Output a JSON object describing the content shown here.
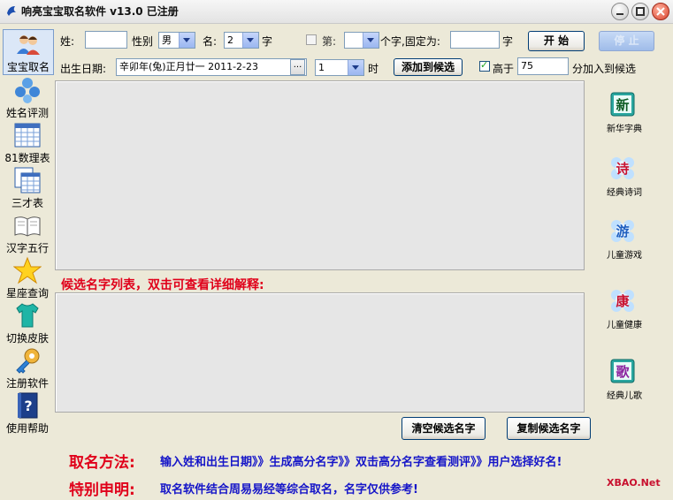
{
  "window": {
    "title": "响亮宝宝取名软件 v13.0  已注册"
  },
  "sidebar": {
    "items": [
      {
        "label": "宝宝取名",
        "icon": "people-icon"
      },
      {
        "label": "姓名评测",
        "icon": "dots-icon"
      },
      {
        "label": "81数理表",
        "icon": "table-icon"
      },
      {
        "label": "三才表",
        "icon": "sheets-icon"
      },
      {
        "label": "汉字五行",
        "icon": "book-icon"
      },
      {
        "label": "星座查询",
        "icon": "star-icon"
      },
      {
        "label": "切换皮肤",
        "icon": "shirt-icon"
      },
      {
        "label": "注册软件",
        "icon": "key-icon"
      },
      {
        "label": "使用帮助",
        "icon": "help-book-icon"
      }
    ]
  },
  "form": {
    "surname_label": "姓:",
    "surname_value": "",
    "gender_label": "性别",
    "gender_value": "男",
    "name_label": "名:",
    "name_count_value": "2",
    "name_unit": "字",
    "nth_label": "第:",
    "nth_value": "",
    "fixed_label": "个字,固定为:",
    "fixed_value": "",
    "fixed_unit": "字",
    "start_button": "开  始",
    "stop_button": "停  止",
    "birth_label": "出生日期:",
    "birth_value": "辛卯年(兔)正月廿一  2011-2-23",
    "birth_browse": "...",
    "hour_value": "1",
    "hour_label": "时",
    "add_button": "添加到候选",
    "above_label": "高于",
    "above_value": "75",
    "above_suffix": "分加入到候选",
    "above_checked": true,
    "nth_checked": false
  },
  "candidates": {
    "caption": "候选名字列表，双击可查看详细解释:",
    "clear_button": "清空候选名字",
    "copy_button": "复制候选名字"
  },
  "right_sidebar": {
    "items": [
      {
        "glyph": "新",
        "label": "新华字典",
        "color": "#0d5b24"
      },
      {
        "glyph": "诗",
        "label": "经典诗词",
        "color": "#c8102e"
      },
      {
        "glyph": "游",
        "label": "儿童游戏",
        "color": "#1f5fbf"
      },
      {
        "glyph": "康",
        "label": "儿童健康",
        "color": "#c8102e"
      },
      {
        "glyph": "歌",
        "label": "经典儿歌",
        "color": "#8a1f9e"
      }
    ]
  },
  "footer": {
    "method_title": "取名方法:",
    "method_text": "输入姓和出生日期》》生成高分名字》》双击高分名字查看测评》》用户选择好名!",
    "notice_title": "特别申明:",
    "notice_text": "取名软件结合周易易经等综合取名，名字仅供参考!",
    "logo_text": "XBAO.Net"
  }
}
